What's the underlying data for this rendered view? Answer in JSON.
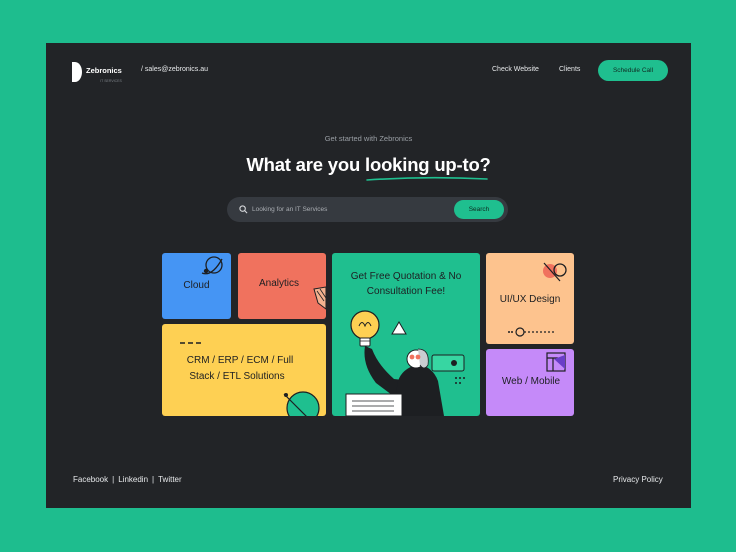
{
  "header": {
    "brand": "Zebronics",
    "brand_sub": "IT SERVICES",
    "email": "/ sales@zebronics.au",
    "nav": [
      "Check Website",
      "Clients"
    ],
    "cta": "Schedule Call"
  },
  "hero": {
    "kicker": "Get started with Zebronics",
    "headline": "What are you looking up-to?",
    "search_placeholder": "Looking for an IT Services",
    "search_button": "Search"
  },
  "tiles": {
    "cloud": "Cloud",
    "analytics": "Analytics",
    "crm_line1": "CRM / ERP / ECM / Full",
    "crm_line2": "Stack / ETL Solutions",
    "quote_line1": "Get Free Quotation & No",
    "quote_line2": "Consultation Fee!",
    "uiux": "UI/UX Design",
    "web": "Web / Mobile"
  },
  "footer": {
    "links": [
      "Facebook",
      "Linkedin",
      "Twitter"
    ],
    "separator": "|",
    "privacy": "Privacy Policy"
  },
  "colors": {
    "page_bg": "#1ebd8e",
    "panel_bg": "#222427",
    "accent": "#1fbf8f",
    "cloud": "#4595f4",
    "analytics": "#f0725e",
    "crm": "#fed053",
    "uiux": "#fdc38e",
    "web": "#c58af9"
  }
}
